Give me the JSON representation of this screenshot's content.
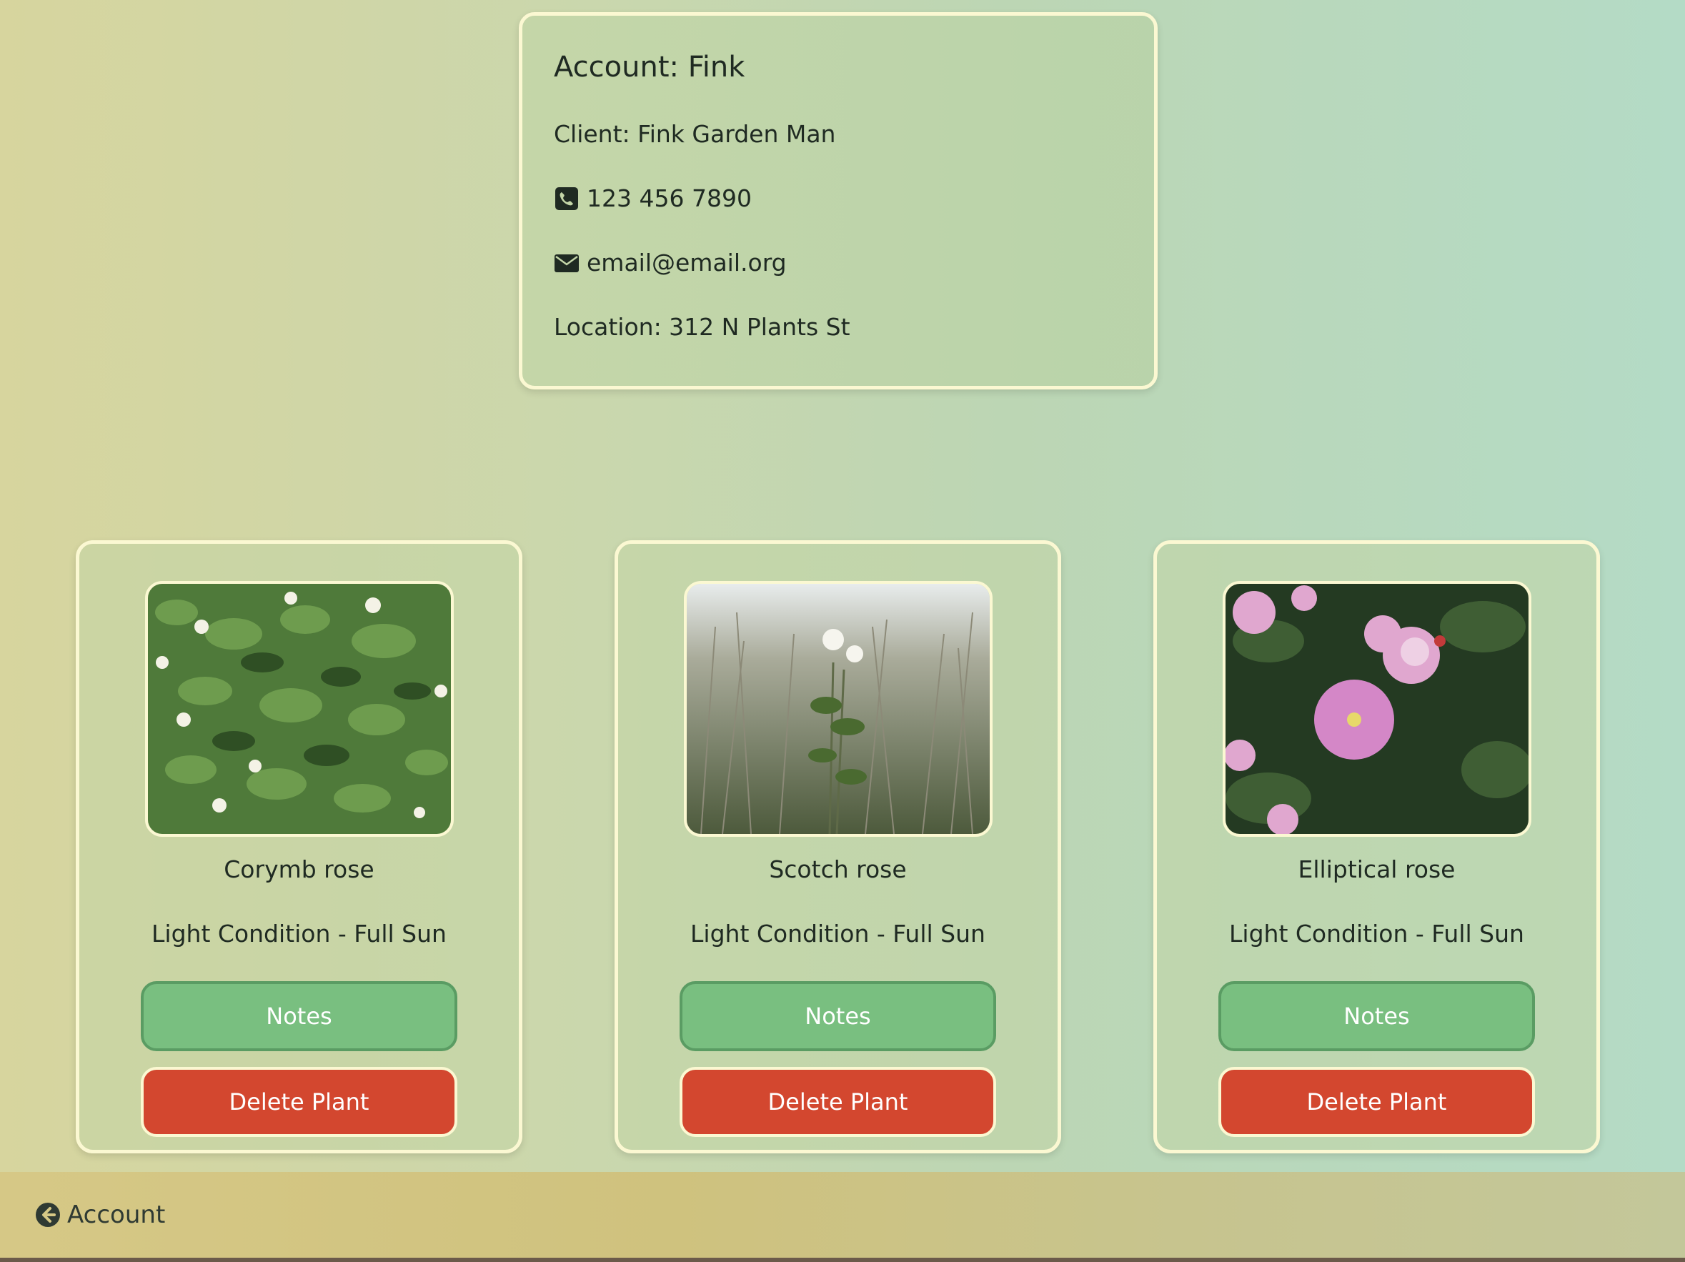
{
  "account": {
    "title": "Account: Fink",
    "client": "Client: Fink Garden Man",
    "phone": "123 456 7890",
    "email": "email@email.org",
    "location": "Location: 312 N Plants St"
  },
  "plants": [
    {
      "name": "Corymb rose",
      "light": "Light Condition - Full Sun",
      "notes_label": "Notes",
      "delete_label": "Delete Plant"
    },
    {
      "name": "Scotch rose",
      "light": "Light Condition - Full Sun",
      "notes_label": "Notes",
      "delete_label": "Delete Plant"
    },
    {
      "name": "Elliptical rose",
      "light": "Light Condition - Full Sun",
      "notes_label": "Notes",
      "delete_label": "Delete Plant"
    }
  ],
  "footer": {
    "back_label": "Account"
  },
  "icons": {
    "phone": "phone-icon",
    "email": "envelope-icon",
    "back": "arrow-left-circle-icon"
  },
  "colors": {
    "notes_button": "#79bf80",
    "delete_button": "#d3472f",
    "card_border": "#fbf8d2"
  }
}
